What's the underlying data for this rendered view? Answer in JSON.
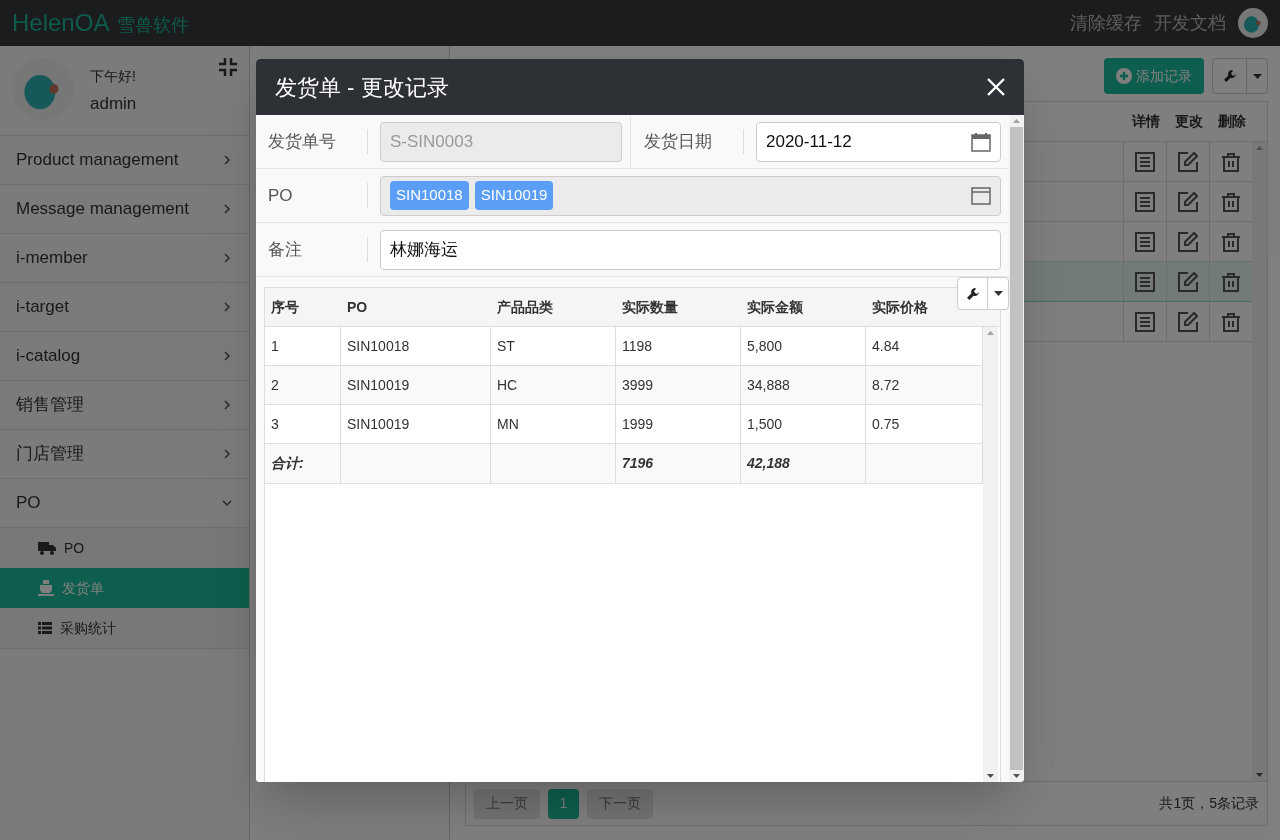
{
  "header": {
    "logo": "HelenOA",
    "logo_sub": "雪兽软件",
    "links": [
      "清除缓存",
      "开发文档"
    ]
  },
  "profile": {
    "greeting": "下午好!",
    "name": "admin"
  },
  "sidebar": {
    "items": [
      {
        "label": "Product management",
        "expanded": false
      },
      {
        "label": "Message management",
        "expanded": false
      },
      {
        "label": "i-member",
        "expanded": false
      },
      {
        "label": "i-target",
        "expanded": false
      },
      {
        "label": "i-catalog",
        "expanded": false
      },
      {
        "label": "销售管理",
        "expanded": false
      },
      {
        "label": "门店管理",
        "expanded": false
      },
      {
        "label": "PO",
        "expanded": true,
        "children": [
          {
            "label": "PO",
            "kind": "truck",
            "selected": false
          },
          {
            "label": "发货单",
            "kind": "ship",
            "selected": true
          },
          {
            "label": "采购统计",
            "kind": "list",
            "selected": false
          }
        ]
      }
    ]
  },
  "main": {
    "add_button": "添加记录",
    "columns": [
      "详情",
      "更改",
      "删除"
    ],
    "rows": [
      {
        "selected": false
      },
      {
        "selected": false
      },
      {
        "selected": false
      },
      {
        "selected": true
      },
      {
        "selected": false
      }
    ],
    "pagination": {
      "prev": "上一页",
      "pages": [
        {
          "label": "1",
          "selected": true
        }
      ],
      "next": "下一页",
      "summary": "共1页，5条记录"
    }
  },
  "modal": {
    "title": "发货单 - 更改记录",
    "fields": {
      "number_label": "发货单号",
      "number_value": "S-SIN0003",
      "date_label": "发货日期",
      "date_value": "2020-11-12",
      "po_label": "PO",
      "po_tags": [
        "SIN10018",
        "SIN10019"
      ],
      "note_label": "备注",
      "note_value": "林娜海运"
    },
    "grid": {
      "columns": [
        "序号",
        "PO",
        "产品品类",
        "实际数量",
        "实际金额",
        "实际价格"
      ],
      "rows": [
        [
          "1",
          "SIN10018",
          "ST",
          "1198",
          "5,800",
          "4.84"
        ],
        [
          "2",
          "SIN10019",
          "HC",
          "3999",
          "34,888",
          "8.72"
        ],
        [
          "3",
          "SIN10019",
          "MN",
          "1999",
          "1,500",
          "0.75"
        ]
      ],
      "total": {
        "label": "合计:",
        "quantity": "7196",
        "amount": "42,188"
      }
    }
  }
}
